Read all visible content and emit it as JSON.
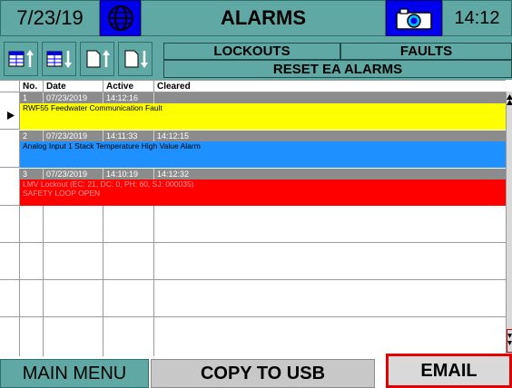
{
  "header": {
    "date": "7/23/19",
    "title": "ALARMS",
    "time": "14:12",
    "globe_icon": "globe-icon",
    "camera_icon": "camera-icon"
  },
  "tabs": {
    "lockouts": "LOCKOUTS",
    "faults": "FAULTS",
    "reset": "RESET EA ALARMS"
  },
  "table": {
    "columns": [
      "No.",
      "Date",
      "Active",
      "Cleared"
    ],
    "alarms": [
      {
        "no": "1",
        "date": "07/23/2019",
        "active": "14:12:16",
        "cleared": "",
        "message": "RWF55 Feedwater Communication Fault",
        "message2": "",
        "color": "#ffff00",
        "text_color": "#000000",
        "selected": true
      },
      {
        "no": "2",
        "date": "07/23/2019",
        "active": "14:11:33",
        "cleared": "14:12:15",
        "message": "Analog Input 1 Stack Temperature High Value Alarm",
        "message2": "",
        "color": "#1e90ff",
        "text_color": "#000000",
        "selected": false
      },
      {
        "no": "3",
        "date": "07/23/2019",
        "active": "14:10:19",
        "cleared": "14:12:32",
        "message": "LMV Lockout (EC: 21, DC: 0, PH: 60, SJ: 000035)",
        "message2": "SAFETY LOOP OPEN",
        "color": "#ff0000",
        "text_color": "#ffffff",
        "selected": false
      }
    ]
  },
  "footer": {
    "main_menu": "MAIN MENU",
    "copy_usb": "COPY TO USB",
    "email": "EMAIL"
  },
  "colors": {
    "teal": "#5fa8a4",
    "blue": "#0000ee",
    "yellow": "#ffff00",
    "sky": "#1e90ff",
    "red": "#ff0000"
  }
}
